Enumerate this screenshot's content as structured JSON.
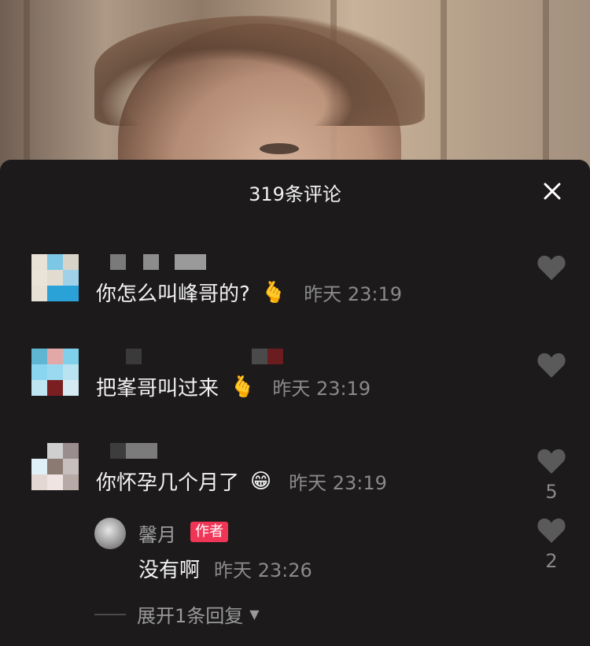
{
  "header": {
    "title": "319条评论",
    "close_icon": "close-icon"
  },
  "comments": [
    {
      "text": "你怎么叫峰哥的?",
      "emoji": "🫰",
      "time": "昨天 23:19",
      "likes": ""
    },
    {
      "text": "把峯哥叫过来",
      "emoji": "🫰",
      "time": "昨天 23:19",
      "likes": ""
    },
    {
      "text": "你怀孕几个月了",
      "emoji": "😁",
      "time": "昨天 23:19",
      "likes": "5"
    }
  ],
  "reply": {
    "name": "馨月",
    "badge": "作者",
    "text": "没有啊",
    "time": "昨天 23:26",
    "likes": "2"
  },
  "expand": {
    "label": "展开1条回复"
  },
  "colors": {
    "sheet_bg": "#1c1a1b",
    "badge": "#f03657",
    "muted": "#8a8a8a"
  }
}
